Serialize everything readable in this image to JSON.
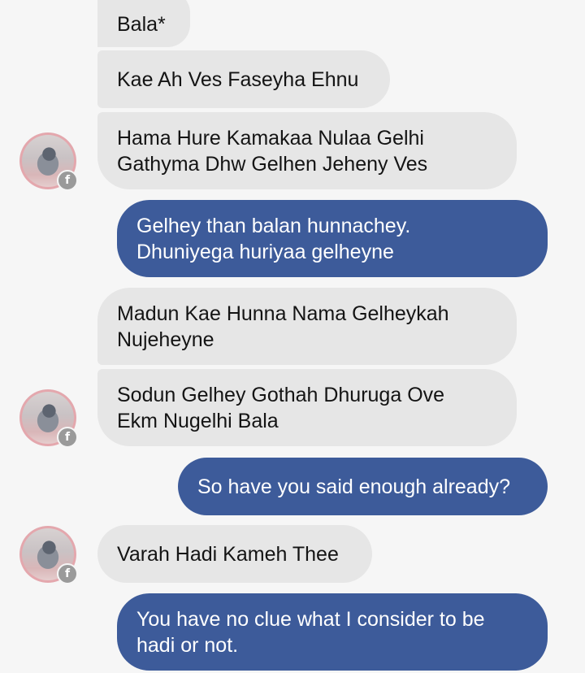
{
  "messages": [
    {
      "text": "Bala*",
      "direction": "incoming"
    },
    {
      "text": "Kae Ah Ves Faseyha Ehnu",
      "direction": "incoming"
    },
    {
      "text": "Hama Hure Kamakaa Nulaa Gelhi\nGathyma Dhw Gelhen Jeheny Ves",
      "direction": "incoming"
    },
    {
      "text": "Gelhey than balan hunnachey.\nDhuniyega huriyaa gelheyne",
      "direction": "outgoing"
    },
    {
      "text": "Madun Kae Hunna Nama Gelheykah\nNujeheyne",
      "direction": "incoming"
    },
    {
      "text": "Sodun Gelhey Gothah Dhuruga Ove\nEkm Nugelhi Bala",
      "direction": "incoming"
    },
    {
      "text": "So have you said enough already?",
      "direction": "outgoing"
    },
    {
      "text": "Varah Hadi Kameh Thee",
      "direction": "incoming"
    },
    {
      "text": "You have no clue what I consider to be\nhadi or not.",
      "direction": "outgoing"
    }
  ],
  "avatar": {
    "badge_icon": "facebook-icon",
    "badge_glyph": "f"
  },
  "colors": {
    "background": "#f6f6f6",
    "incoming_bubble": "#e6e6e6",
    "outgoing_bubble": "#3d5b9a",
    "outgoing_text": "#ffffff"
  }
}
